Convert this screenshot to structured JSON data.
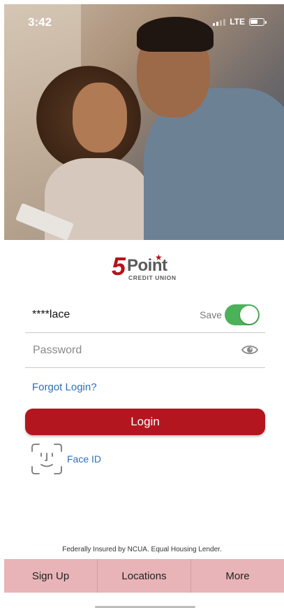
{
  "status_bar": {
    "time": "3:42",
    "network": "LTE"
  },
  "brand": {
    "logo_number": "5",
    "logo_word": "Point",
    "logo_tagline": "CREDIT UNION",
    "primary_color": "#b3161f",
    "link_color": "#2f6fb6"
  },
  "login": {
    "username_value": "****lace",
    "save_label": "Save",
    "save_toggle_on": true,
    "password_placeholder": "Password",
    "forgot_label": "Forgot Login?",
    "login_button": "Login",
    "face_id_label": "Face ID"
  },
  "footer": {
    "disclaimer": "Federally Insured by NCUA. Equal Housing Lender."
  },
  "tabs": [
    {
      "label": "Sign Up"
    },
    {
      "label": "Locations"
    },
    {
      "label": "More"
    }
  ],
  "icons": {
    "password_visibility": "eye-icon",
    "face_id": "face-id-icon",
    "battery": "battery-icon",
    "signal": "signal-icon"
  }
}
